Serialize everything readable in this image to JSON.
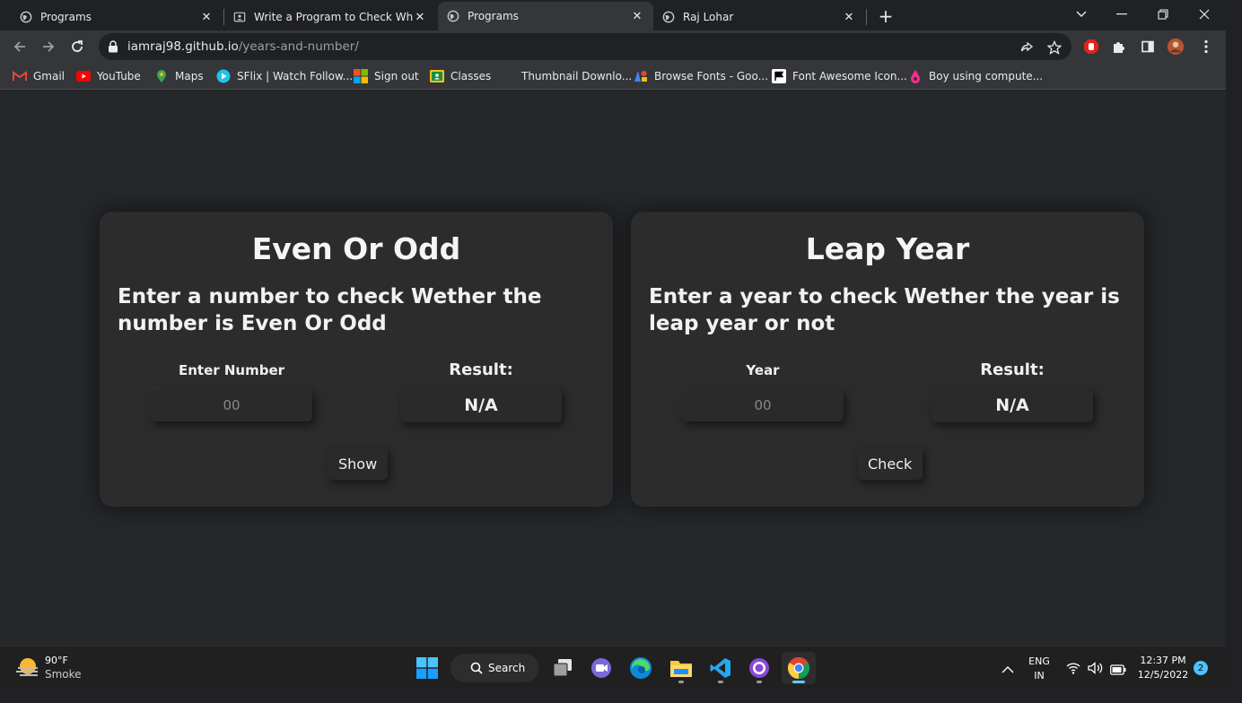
{
  "browser": {
    "tabs": [
      {
        "title": "Programs",
        "icon": "globe-icon",
        "active": false
      },
      {
        "title": "Write a Program to Check Wheth",
        "icon": "page-icon",
        "active": false
      },
      {
        "title": "Programs",
        "icon": "globe-icon",
        "active": true
      },
      {
        "title": "Raj Lohar",
        "icon": "globe-icon",
        "active": false
      }
    ],
    "new_tab_label": "+",
    "url_host": "iamraj98.github.io",
    "url_path": "/years-and-number/",
    "bookmarks": [
      {
        "label": "Gmail",
        "icon": "gmail-icon"
      },
      {
        "label": "YouTube",
        "icon": "youtube-icon"
      },
      {
        "label": "Maps",
        "icon": "maps-icon"
      },
      {
        "label": "SFlix | Watch Follow...",
        "icon": "sflix-icon"
      },
      {
        "label": "Sign out",
        "icon": "microsoft-icon"
      },
      {
        "label": "Classes",
        "icon": "classroom-icon"
      },
      {
        "label": "Thumbnail Downlo...",
        "icon": "blank-icon"
      },
      {
        "label": "Browse Fonts - Goo...",
        "icon": "google-fonts-icon"
      },
      {
        "label": "Font Awesome Icon...",
        "icon": "fontawesome-icon"
      },
      {
        "label": "Boy using compute...",
        "icon": "pink-drop-icon"
      }
    ]
  },
  "even_odd": {
    "title": "Even Or Odd",
    "description": "Enter a number to check Wether the number is Even Or Odd",
    "input_label": "Enter Number",
    "input_placeholder": "00",
    "result_label": "Result:",
    "result_value": "N/A",
    "button_label": "Show"
  },
  "leap_year": {
    "title": "Leap Year",
    "description": "Enter a year to check Wether the year is leap year or not",
    "input_label": "Year",
    "input_placeholder": "00",
    "result_label": "Result:",
    "result_value": "N/A",
    "button_label": "Check"
  },
  "taskbar": {
    "weather_temp": "90°F",
    "weather_desc": "Smoke",
    "search_label": "Search",
    "lang_top": "ENG",
    "lang_bottom": "IN",
    "time": "12:37 PM",
    "date": "12/5/2022",
    "notification_count": "2"
  },
  "colors": {
    "page_bg": "#25282b",
    "card_bg": "#2d2c2c",
    "chrome_dark": "#202124",
    "chrome_toolbar": "#35363a"
  }
}
